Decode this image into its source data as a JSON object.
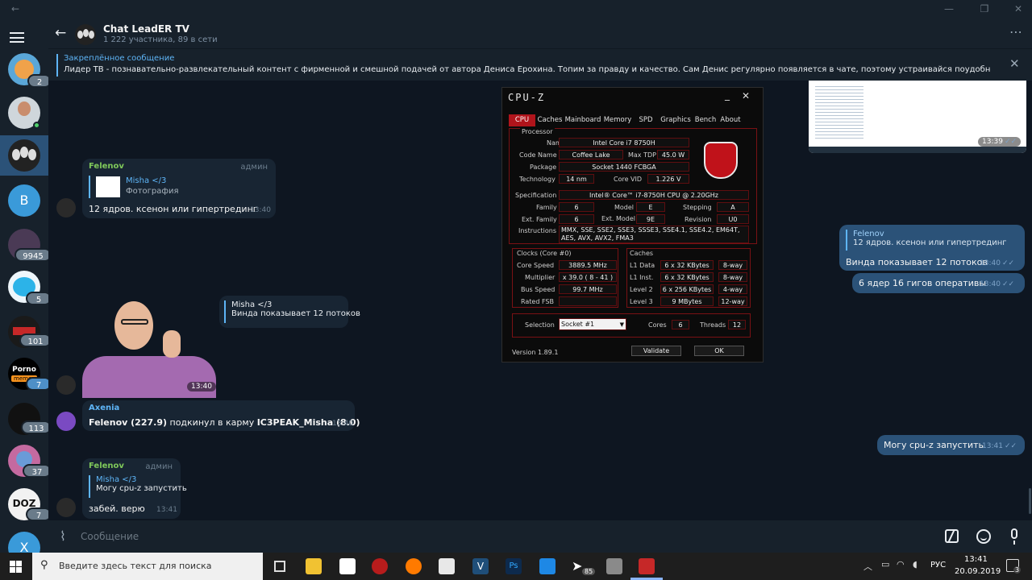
{
  "chat": {
    "title": "Chat LeadER TV",
    "subtitle": "1 222 участника, 89 в сети"
  },
  "pinned": {
    "label": "Закреплённое сообщение",
    "text": "Лидер ТВ - познавательно-развлекательный контент с фирменной и смешной подачей от автора Дениса Ерохина. Топим за правду и качество.  Сам Денис регулярно появляется в чате, поэтому устраивайся поудобнее, принеси чай, хавчик и гоу к н..."
  },
  "sidebar": {
    "badges": [
      "2",
      "9945",
      "5",
      "101",
      "7",
      "113",
      "37",
      "7"
    ],
    "letters": {
      "b": "B",
      "x": "X"
    },
    "porno_label": "Porno",
    "porno_sub": "memes",
    "doz_label": "DOZ"
  },
  "messages": {
    "m1": {
      "name": "Felenov",
      "role": "админ",
      "reply_name": "Misha </3",
      "reply_text": "Фотография",
      "text": "12 ядров. ксенон или гипертрединг",
      "time": "13:40"
    },
    "m2": {
      "reply_name": "Misha </3",
      "reply_text": "Винда показывает 12 потоков"
    },
    "m3": {
      "time": "13:40"
    },
    "m4": {
      "name": "Axenia",
      "text_a": "Felenov (227.9)",
      "text_b": " подкинул в карму ",
      "text_c": "IC3PEAK_Misha (8.0)",
      "time": "13:40"
    },
    "m5": {
      "name": "Felenov",
      "role": "админ",
      "reply_name": "Misha </3",
      "reply_text": "Могу cpu-z запустить",
      "text": "забей. верю",
      "time": "13:41"
    },
    "o1": {
      "time": "13:39"
    },
    "o2": {
      "reply_name": "Felenov",
      "reply_text": "12 ядров. ксенон или гипертрединг",
      "text": "Винда показывает 12 потоков",
      "time": "13:40"
    },
    "o3": {
      "text": "6 ядер 16 гигов оперативы",
      "time": "13:40"
    },
    "o4": {
      "text": "Могу cpu-z запустить",
      "time": "13:41"
    }
  },
  "input": {
    "placeholder": "Сообщение"
  },
  "cpuz": {
    "title": "CPU-Z",
    "tabs": [
      "CPU",
      "Caches",
      "Mainboard",
      "Memory",
      "SPD",
      "Graphics",
      "Bench",
      "About"
    ],
    "section_processor": "Processor",
    "name_label": "Name",
    "name": "Intel Core i7 8750H",
    "codename_label": "Code Name",
    "codename": "Coffee Lake",
    "maxtdp_label": "Max TDP",
    "maxtdp": "45.0 W",
    "package_label": "Package",
    "package": "Socket 1440 FCBGA",
    "tech_label": "Technology",
    "tech": "14 nm",
    "vid_label": "Core VID",
    "vid": "1.226 V",
    "spec_label": "Specification",
    "spec": "Intel® Core™ i7-8750H CPU @ 2.20GHz",
    "family_label": "Family",
    "family": "6",
    "model_label": "Model",
    "model": "E",
    "stepping_label": "Stepping",
    "stepping": "A",
    "extfamily_label": "Ext. Family",
    "extfamily": "6",
    "extmodel_label": "Ext. Model",
    "extmodel": "9E",
    "revision_label": "Revision",
    "revision": "U0",
    "instr_label": "Instructions",
    "instr1": "MMX, SSE, SSE2, SSE3, SSSE3, SSE4.1, SSE4.2, EM64T,",
    "instr2": "AES, AVX, AVX2, FMA3",
    "clocks_title": "Clocks (Core #0)",
    "corespeed_label": "Core Speed",
    "corespeed": "3889.5 MHz",
    "mult_label": "Multiplier",
    "mult": "x 39.0 ( 8 - 41 )",
    "bus_label": "Bus Speed",
    "bus": "99.7 MHz",
    "fsb_label": "Rated FSB",
    "caches_title": "Caches",
    "l1d_label": "L1 Data",
    "l1d": "6 x 32 KBytes",
    "l1d_way": "8-way",
    "l1i_label": "L1 Inst.",
    "l1i": "6 x 32 KBytes",
    "l1i_way": "8-way",
    "l2_label": "Level 2",
    "l2": "6 x 256 KBytes",
    "l2_way": "4-way",
    "l3_label": "Level 3",
    "l3": "9 MBytes",
    "l3_way": "12-way",
    "selection_label": "Selection",
    "selection": "Socket #1",
    "cores_label": "Cores",
    "cores": "6",
    "threads_label": "Threads",
    "threads": "12",
    "version": "Version 1.89.1",
    "validate": "Validate",
    "ok": "OK"
  },
  "taskbar": {
    "search_placeholder": "Введите здесь текст для поиска",
    "tg_badge": "85",
    "lang": "РУС",
    "time": "13:41",
    "date": "20.09.2019",
    "notif": "3"
  },
  "colors": {
    "accent": "#5eb5f7",
    "outgoing": "#2b5278",
    "incoming": "#182533",
    "admin_name": "#7fc85a",
    "cpuz_red": "#b0141b"
  }
}
